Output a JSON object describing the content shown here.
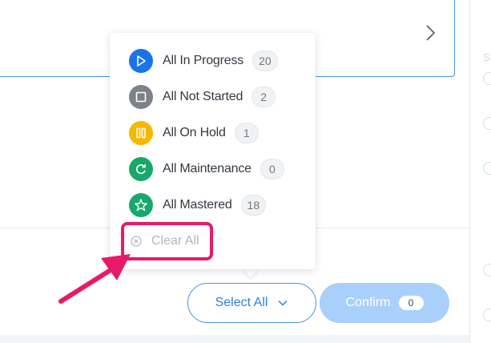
{
  "status_menu": {
    "items": [
      {
        "label": "All In Progress",
        "count": "20",
        "icon": "play-icon",
        "color": "#1a73e8"
      },
      {
        "label": "All Not Started",
        "count": "2",
        "icon": "square-icon",
        "color": "#7d8288"
      },
      {
        "label": "All On Hold",
        "count": "1",
        "icon": "pause-icon",
        "color": "#f5b800"
      },
      {
        "label": "All Maintenance",
        "count": "0",
        "icon": "refresh-icon",
        "color": "#17a86b"
      },
      {
        "label": "All Mastered",
        "count": "18",
        "icon": "star-icon",
        "color": "#17a86b"
      }
    ],
    "clear_label": "Clear All"
  },
  "footer": {
    "select_all_label": "Select All",
    "confirm_label": "Confirm",
    "confirm_count": "0"
  },
  "annotation": {
    "highlight_color": "#e8196a"
  },
  "colors": {
    "accent": "#4a90e2",
    "confirm_disabled": "#a8d0fa"
  }
}
